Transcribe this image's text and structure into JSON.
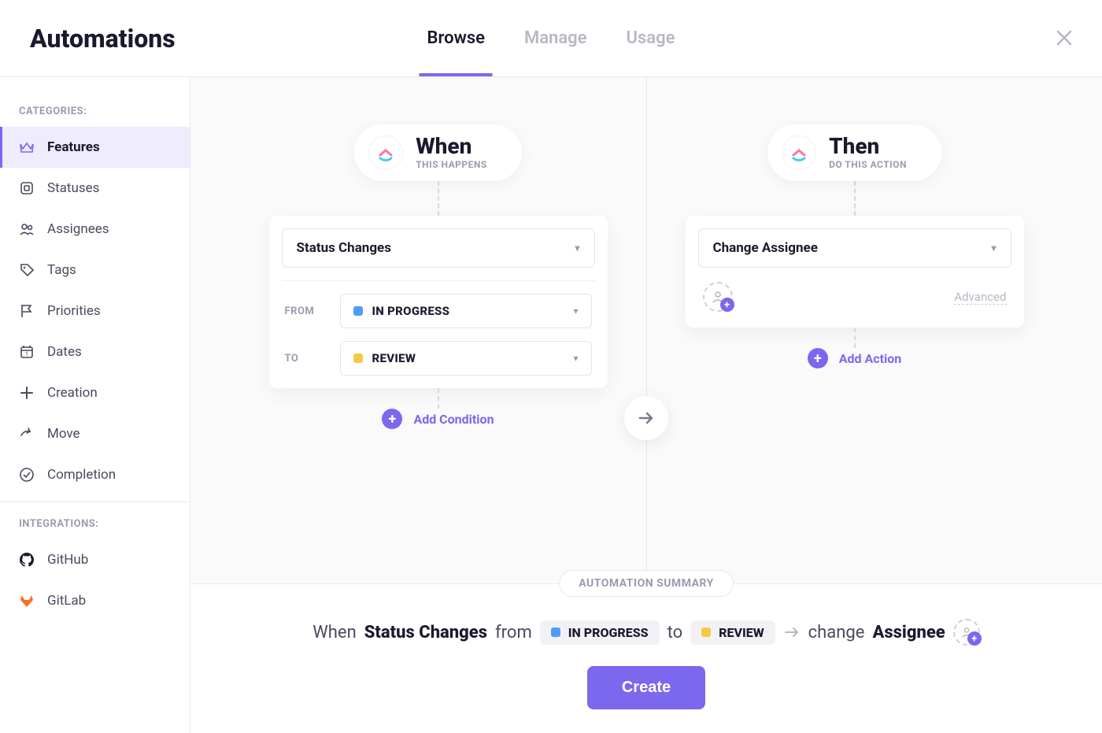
{
  "header": {
    "title": "Automations",
    "tabs": [
      "Browse",
      "Manage",
      "Usage"
    ],
    "active_tab": 0
  },
  "sidebar": {
    "categories_label": "CATEGORIES:",
    "integrations_label": "INTEGRATIONS:",
    "categories": [
      {
        "label": "Features",
        "icon": "crown-icon"
      },
      {
        "label": "Statuses",
        "icon": "square-icon"
      },
      {
        "label": "Assignees",
        "icon": "people-icon"
      },
      {
        "label": "Tags",
        "icon": "tag-icon"
      },
      {
        "label": "Priorities",
        "icon": "flag-icon"
      },
      {
        "label": "Dates",
        "icon": "calendar-icon"
      },
      {
        "label": "Creation",
        "icon": "plus-icon"
      },
      {
        "label": "Move",
        "icon": "share-icon"
      },
      {
        "label": "Completion",
        "icon": "check-circle-icon"
      }
    ],
    "integrations": [
      {
        "label": "GitHub",
        "icon": "github-icon"
      },
      {
        "label": "GitLab",
        "icon": "gitlab-icon"
      }
    ]
  },
  "when": {
    "title": "When",
    "subtitle": "THIS HAPPENS",
    "trigger": "Status Changes",
    "from_label": "FROM",
    "to_label": "TO",
    "from_status": {
      "name": "IN PROGRESS",
      "color": "#4f9df8"
    },
    "to_status": {
      "name": "REVIEW",
      "color": "#f7c943"
    },
    "add_condition": "Add Condition"
  },
  "then": {
    "title": "Then",
    "subtitle": "DO THIS ACTION",
    "action": "Change Assignee",
    "advanced": "Advanced",
    "add_action": "Add Action"
  },
  "summary": {
    "badge": "AUTOMATION SUMMARY",
    "when_word": "When",
    "trigger": "Status Changes",
    "from_word": "from",
    "to_word": "to",
    "from_status": {
      "name": "IN PROGRESS",
      "color": "#4f9df8"
    },
    "to_status": {
      "name": "REVIEW",
      "color": "#f7c943"
    },
    "change_word": "change",
    "assignee_word": "Assignee"
  },
  "create_button": "Create"
}
